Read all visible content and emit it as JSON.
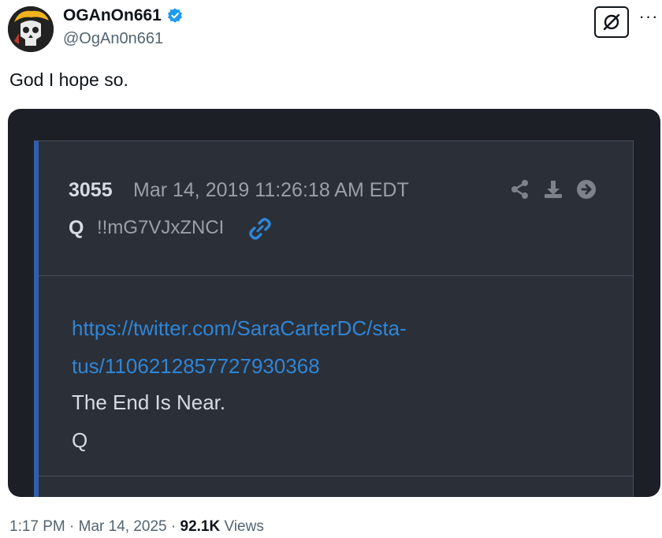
{
  "author": {
    "display_name": "OGAnOn661",
    "handle": "@OgAn0n661",
    "verified_icon": "verified-badge-icon",
    "avatar_icon": "skull-avatar"
  },
  "tweet": {
    "text": "God I hope so."
  },
  "actions": {
    "grok_icon": "grok-icon",
    "more_label": "···"
  },
  "embedded_post": {
    "number": "3055",
    "date": "Mar 14, 2019 11:26:18 AM EDT",
    "author": "Q",
    "tripcode": "!!mG7VJxZNCI",
    "link_line1": "https://twitter.com/SaraCarterDC/sta-",
    "link_line2": "tus/1106212857727930368",
    "line3": "The End Is Near.",
    "line4": "Q",
    "icons": [
      "share-icon",
      "download-icon",
      "arrow-right-circle-icon",
      "link-icon"
    ],
    "colors": {
      "link": "#2f86d6",
      "accent_bar": "#2f5fae",
      "background": "#2b2f38"
    }
  },
  "meta": {
    "time": "1:17 PM",
    "sep1": "·",
    "date": "Mar 14, 2025",
    "sep2": "·",
    "views_count": "92.1K",
    "views_label": "Views"
  }
}
